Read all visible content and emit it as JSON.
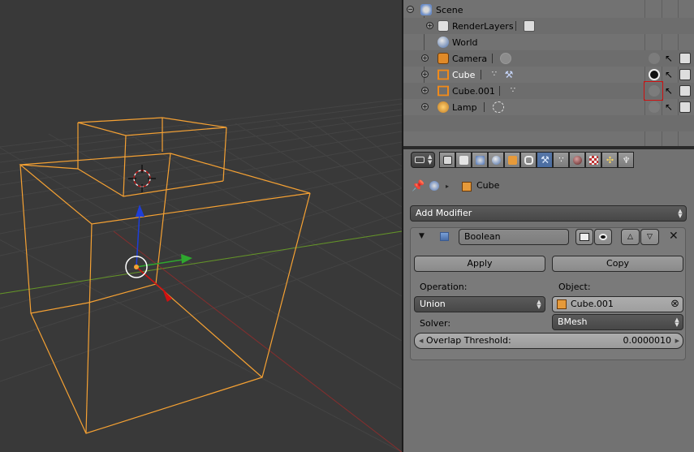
{
  "outliner": {
    "rows": [
      {
        "label": "Scene",
        "icon": "scene-icon"
      },
      {
        "label": "RenderLayers",
        "icon": "renderlayers-icon"
      },
      {
        "label": "World",
        "icon": "world-icon"
      },
      {
        "label": "Camera",
        "icon": "camera-object-icon"
      },
      {
        "label": "Cube",
        "icon": "mesh-object-icon",
        "selected": true
      },
      {
        "label": "Cube.001",
        "icon": "mesh-object-icon"
      },
      {
        "label": "Lamp",
        "icon": "lamp-object-icon"
      }
    ]
  },
  "properties": {
    "breadcrumb_object": "Cube",
    "add_modifier_label": "Add Modifier",
    "modifier": {
      "name": "Boolean",
      "apply_label": "Apply",
      "copy_label": "Copy",
      "operation_label": "Operation:",
      "operation_value": "Union",
      "object_label": "Object:",
      "object_value": "Cube.001",
      "solver_label": "Solver:",
      "solver_value": "BMesh",
      "overlap_label": "Overlap Threshold:",
      "overlap_value": "0.0000010"
    }
  },
  "colors": {
    "viewport_bg": "#393939",
    "selection_orange": "#f5a133",
    "panel_bg": "#727272",
    "active_tab": "#5777a8",
    "highlight_box": "#d01010"
  }
}
